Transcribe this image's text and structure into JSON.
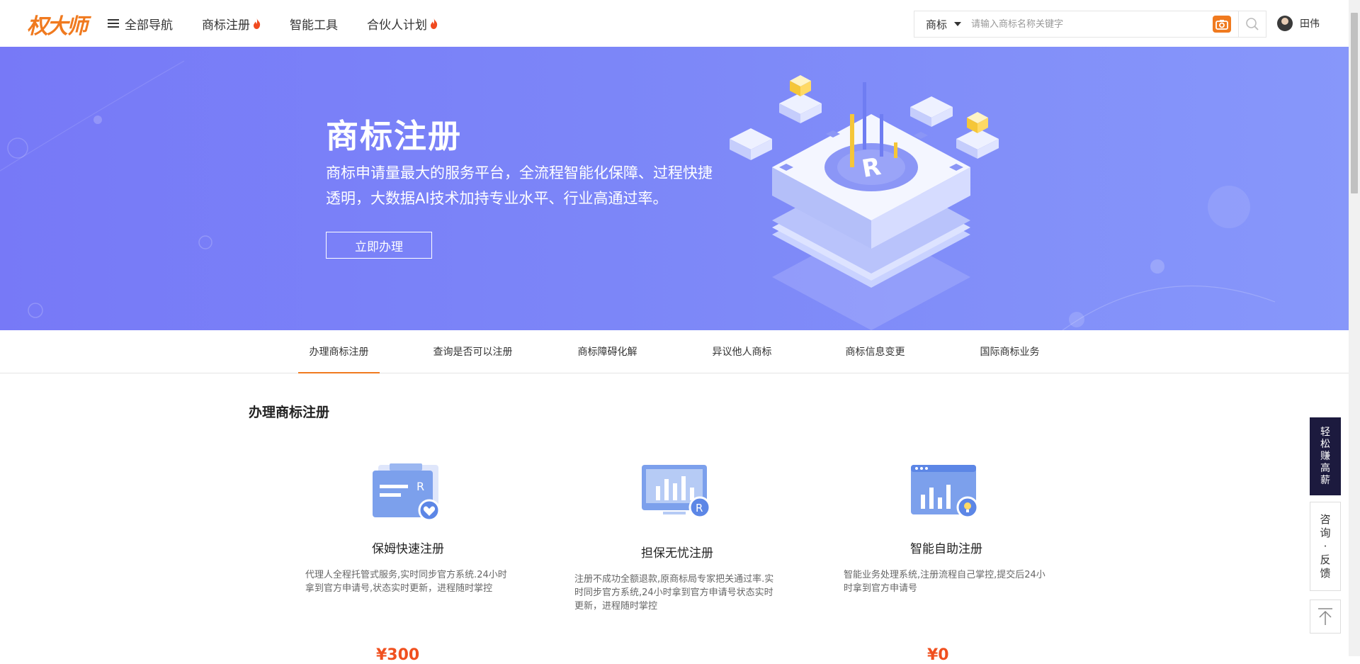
{
  "header": {
    "logo": "权大师",
    "nav": [
      {
        "label": "全部导航",
        "icon": "menu-icon"
      },
      {
        "label": "商标注册",
        "icon": "fire-icon"
      },
      {
        "label": "智能工具"
      },
      {
        "label": "合伙人计划",
        "icon": "fire-icon"
      }
    ],
    "search": {
      "type": "商标",
      "placeholder": "请输入商标名称关键字"
    },
    "user": {
      "name": "田伟"
    }
  },
  "banner": {
    "title": "商标注册",
    "description": "商标申请量最大的服务平台，全流程智能化保障、过程快捷透明，大数据AI技术加持专业水平、行业高通过率。",
    "button": "立即办理"
  },
  "tabs": [
    {
      "label": "办理商标注册",
      "active": true
    },
    {
      "label": "查询是否可以注册"
    },
    {
      "label": "商标障碍化解"
    },
    {
      "label": "异议他人商标"
    },
    {
      "label": "商标信息变更"
    },
    {
      "label": "国际商标业务"
    }
  ],
  "section": {
    "title": "办理商标注册",
    "cards": [
      {
        "title": "保姆快速注册",
        "description": "代理人全程托管式服务,实时同步官方系统.24小时拿到官方申请号,状态实时更新，进程随时掌控",
        "price": "¥300",
        "icon": "trademark-folder-heart-icon"
      },
      {
        "title": "担保无忧注册",
        "description": "注册不成功全额退款,原商标局专家把关通过率.实时同步官方系统,24小时拿到官方申请号状态实时更新，进程随时掌控",
        "price": "",
        "icon": "monitor-chart-trademark-icon"
      },
      {
        "title": "智能自助注册",
        "description": "智能业务处理系统,注册流程自己掌控,提交后24小时拿到官方申请号",
        "price": "¥0",
        "icon": "browser-chart-bulb-icon"
      }
    ]
  },
  "side": {
    "earn": [
      "轻",
      "松",
      "赚",
      "高",
      "薪"
    ],
    "feedback": [
      "咨",
      "询",
      "·",
      "反",
      "馈"
    ],
    "top_icon": "back-to-top-icon"
  },
  "colors": {
    "accent": "#f07a1f",
    "banner": "#7b84f8",
    "price": "#f0501f",
    "side_dark": "#1c1a3e"
  }
}
